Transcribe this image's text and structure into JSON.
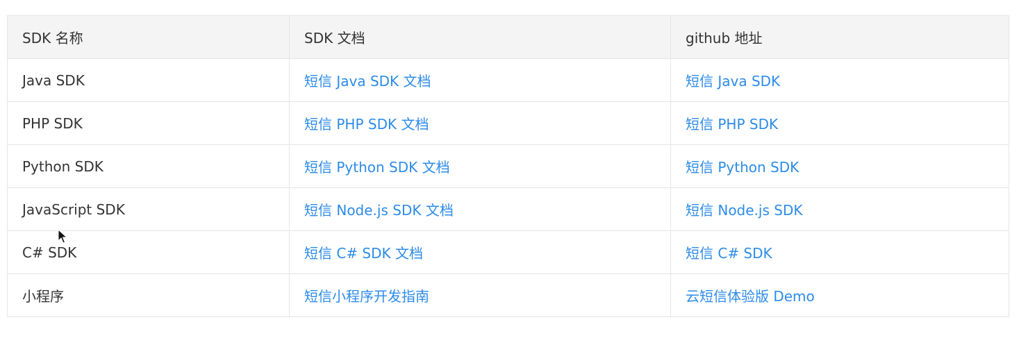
{
  "table": {
    "headers": [
      "SDK 名称",
      "SDK 文档",
      "github 地址"
    ],
    "rows": [
      {
        "name": "Java SDK",
        "doc": "短信 Java SDK 文档",
        "github": "短信 Java SDK"
      },
      {
        "name": "PHP SDK",
        "doc": "短信 PHP SDK 文档",
        "github": "短信 PHP SDK"
      },
      {
        "name": "Python SDK",
        "doc": "短信 Python SDK 文档",
        "github": "短信 Python SDK"
      },
      {
        "name": "JavaScript SDK",
        "doc": "短信 Node.js SDK 文档",
        "github": "短信 Node.js SDK"
      },
      {
        "name": "C# SDK",
        "doc": "短信 C# SDK 文档",
        "github": "短信 C# SDK"
      },
      {
        "name": "小程序",
        "doc": "短信小程序开发指南",
        "github": "云短信体验版 Demo"
      }
    ]
  },
  "colors": {
    "link": "#2c8be8",
    "text": "#333333",
    "header_bg": "#f4f4f4",
    "border": "#e5e5e5"
  },
  "icons": {
    "cursor": "mouse-pointer-icon"
  }
}
